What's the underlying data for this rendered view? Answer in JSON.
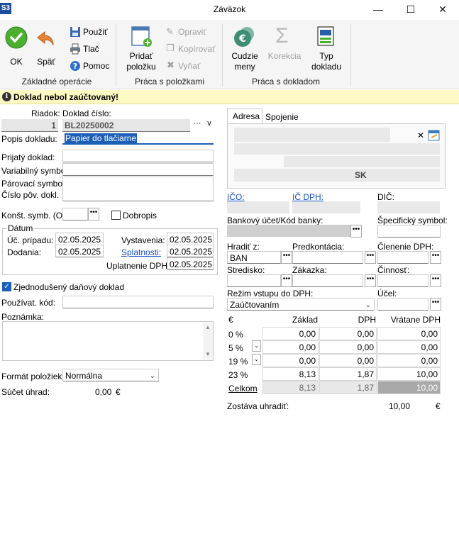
{
  "window": {
    "app_icon": "S3",
    "title": "Záväzok",
    "minimize": "—",
    "maximize": "☐",
    "close": "✕"
  },
  "ribbon": {
    "ok": "OK",
    "back": "Späť",
    "use": "Použiť",
    "print": "Tlač",
    "help": "Pomoc",
    "group_basic": "Základné operácie",
    "add_item": "Pridať\npoložku",
    "add_item_l1": "Pridať",
    "add_item_l2": "položku",
    "edit": "Opraviť",
    "copy": "Kopírovať",
    "cut": "Vyňať",
    "group_items": "Práca s položkami",
    "foreign_l1": "Cudzie",
    "foreign_l2": "meny",
    "correction": "Korekcia",
    "doctype_l1": "Typ",
    "doctype_l2": "dokladu",
    "group_doc": "Práca s dokladom"
  },
  "warning": {
    "icon": "info-icon",
    "text": "Doklad nebol zaúčtovaný!"
  },
  "form": {
    "row_label": "Riadok:",
    "row_value": "1",
    "docnum_label": "Doklad číslo:",
    "docnum_value": "BL20250002",
    "desc_label": "Popis dokladu:",
    "desc_value": "Papier do tlačiarne",
    "received_label": "Prijatý doklad:",
    "varsym_label": "Variabilný symbol:",
    "pairsym_label": "Párovací symbol:",
    "origdoc_label": "Číslo pôv. dokl.",
    "constsym_label": "Konšt. symb. (O):",
    "dobropis_label": "Dobropis",
    "date_group": "Dátum",
    "uc_pripadu_label": "Úč. prípadu:",
    "uc_pripadu_value": "02.05.2025",
    "dodania_label": "Dodania:",
    "dodania_value": "02.05.2025",
    "vystavenia_label": "Vystavenia:",
    "vystavenia_value": "02.05.2025",
    "splatnosti_label": "Splatnosti:",
    "splatnosti_value": "02.05.2025",
    "uplatnenie_label": "Uplatnenie DPH:",
    "uplatnenie_value": "02.05.2025",
    "simplified_label": "Zjednodušený daňový doklad",
    "user_code_label": "Používat. kód:",
    "note_label": "Poznámka:",
    "format_label": "Formát položiek:",
    "format_value": "Normálna",
    "sum_label": "Súčet úhrad:",
    "sum_value": "0,00",
    "sum_currency": "€"
  },
  "right": {
    "tab_address": "Adresa",
    "tab_link": "Spojenie",
    "country": "SK",
    "ico_label": "IČO:",
    "icdph_label": "IČ DPH:",
    "dic_label": "DIČ:",
    "bank_label": "Bankový účet/Kód banky:",
    "specsym_label": "Špecifický symbol:",
    "pay_label": "Hradiť z:",
    "pay_value": "BAN",
    "precont_label": "Predkontácia:",
    "vatsplit_label": "Členenie DPH:",
    "center_label": "Stredisko:",
    "order_label": "Zákazka:",
    "activity_label": "Činnosť:",
    "vatmode_label": "Režim vstupu do DPH:",
    "vatmode_value": "Zaúčtovaním",
    "account_label": "Účel:",
    "col_currency": "€",
    "col_base": "Základ",
    "col_vat": "DPH",
    "col_incl": "Vrátane DPH",
    "rows": [
      {
        "rate": "0 %",
        "base": "0,00",
        "vat": "0,00",
        "incl": "0,00"
      },
      {
        "rate": "5 %",
        "base": "0,00",
        "vat": "0,00",
        "incl": "0,00"
      },
      {
        "rate": "19 %",
        "base": "0,00",
        "vat": "0,00",
        "incl": "0,00"
      },
      {
        "rate": "23 %",
        "base": "8,13",
        "vat": "1,87",
        "incl": "10,00"
      }
    ],
    "total_label": "Celkom",
    "total_base": "8,13",
    "total_vat": "1,87",
    "total_incl": "10,00",
    "remain_label": "Zostáva uhradiť:",
    "remain_value": "10,00",
    "remain_currency": "€"
  }
}
